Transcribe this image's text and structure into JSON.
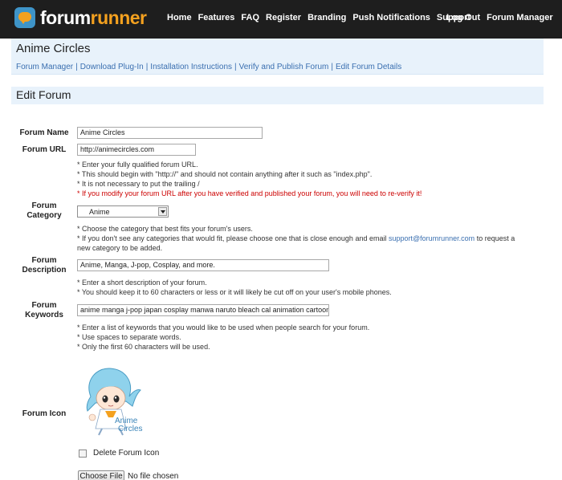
{
  "brand": {
    "name_a": "forum",
    "name_b": "runner"
  },
  "nav": {
    "left": [
      "Home",
      "Features",
      "FAQ",
      "Register",
      "Branding",
      "Push Notifications",
      "Support"
    ],
    "right": [
      "Log Out",
      "Forum Manager"
    ]
  },
  "header": {
    "title": "Anime Circles",
    "crumbs": [
      "Forum Manager",
      "Download Plug-In",
      "Installation Instructions",
      "Verify and Publish Forum",
      "Edit Forum Details"
    ]
  },
  "section": {
    "title": "Edit Forum"
  },
  "form": {
    "name": {
      "label": "Forum Name",
      "value": "Anime Circles"
    },
    "url": {
      "label": "Forum URL",
      "value": "http://animecircles.com",
      "hints": [
        "* Enter your fully qualified forum URL.",
        "* This should begin with \"http://\" and should not contain anything after it such as \"index.php\".",
        "* It is not necessary to put the trailing /"
      ],
      "warning": "* If you modify your forum URL after you have verified and published your forum, you will need to re-verify it!"
    },
    "category": {
      "label_1": "Forum",
      "label_2": "Category",
      "selected": "Anime",
      "hint_1": "* Choose the category that best fits your forum's users.",
      "hint_2_pre": "* If you don't see any categories that would fit, please choose one that is close enough and email",
      "hint_2_link": "support@forumrunner.com",
      "hint_2_post": "to request a",
      "hint_3": "new category to be added."
    },
    "description": {
      "label_1": "Forum",
      "label_2": "Description",
      "value": "Anime, Manga, J-pop, Cosplay, and more.",
      "hints": [
        "* Enter a short description of your forum.",
        "* You should keep it to 60 characters or less or it will likely be cut off on your user's mobile phones."
      ]
    },
    "keywords": {
      "label_1": "Forum",
      "label_2": "Keywords",
      "value": "anime manga j-pop japan cosplay manwa naruto bleach cal animation cartoon",
      "hints": [
        "* Enter a list of keywords that you would like to be used when people search for your forum.",
        "* Use spaces to separate words.",
        "* Only the first 60 characters will be used."
      ]
    },
    "icon": {
      "label": "Forum Icon",
      "art_text_1": "Anime",
      "art_text_2": "Circles"
    },
    "delete_icon": {
      "label": "Delete Forum Icon",
      "checked": false
    },
    "file": {
      "button": "Choose File",
      "status": "No file chosen"
    }
  },
  "colors": {
    "topbar": "#1e1e1e",
    "accent": "#f4a11f",
    "link": "#3a6fb0",
    "panel": "#e8f2fb",
    "warning": "#cc0000"
  }
}
